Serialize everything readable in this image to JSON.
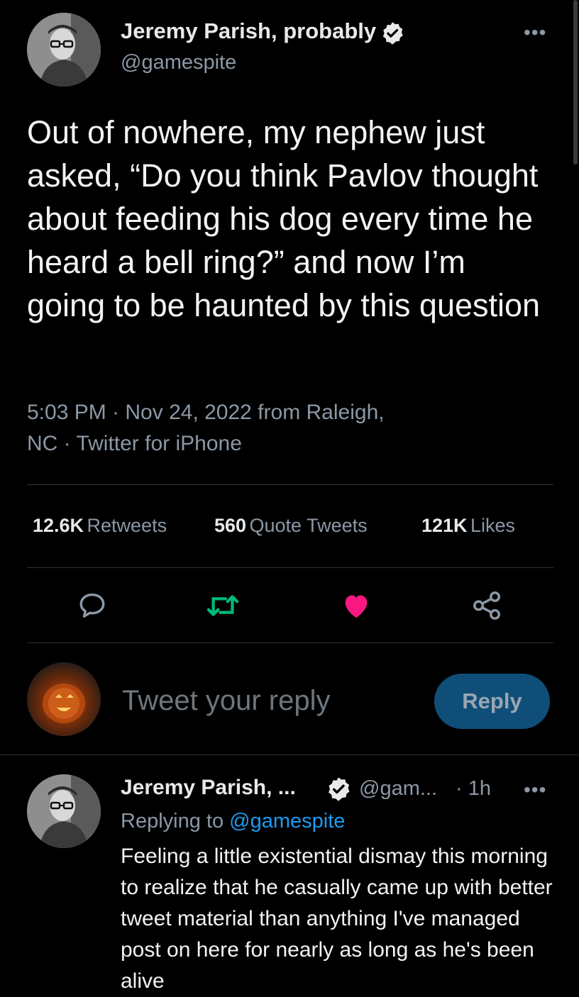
{
  "tweet": {
    "author_name": "Jeremy Parish, probably",
    "author_handle": "@gamespite",
    "more_label": "•••",
    "text": "Out of nowhere, my nephew just asked, “Do you think Pavlov thought about feeding his dog every time he heard a bell ring?” and now I’m going to be haunted by this question",
    "meta_line1": "5:03 PM · Nov 24, 2022 from Raleigh,",
    "meta_line2": "NC · Twitter for iPhone"
  },
  "stats": {
    "retweets_count": "12.6K",
    "retweets_label": "Retweets",
    "quotes_count": "560",
    "quotes_label": "Quote Tweets",
    "likes_count": "121K",
    "likes_label": "Likes"
  },
  "actions": {
    "icons": [
      "reply-icon",
      "retweet-icon",
      "like-icon",
      "share-icon"
    ]
  },
  "compose": {
    "placeholder": "Tweet your reply",
    "reply_button": "Reply"
  },
  "reply": {
    "author_name": "Jeremy Parish, ...",
    "author_handle": "@gam...",
    "time": "· 1h",
    "more_label": "•••",
    "replying_prefix": "Replying to",
    "replying_handle": "@gamespite",
    "text": "Feeling a little existential dismay this morning to realize that he casually came up with better tweet material than anything I've managed post on here for nearly as long as he's been alive"
  },
  "colors": {
    "background": "#000000",
    "text": "#e7e9ea",
    "muted": "#8b98a5",
    "link": "#1d9bf0",
    "retweet_green": "#00ba7c",
    "like_pink": "#f91880",
    "reply_button_bg": "#0f4e78"
  }
}
